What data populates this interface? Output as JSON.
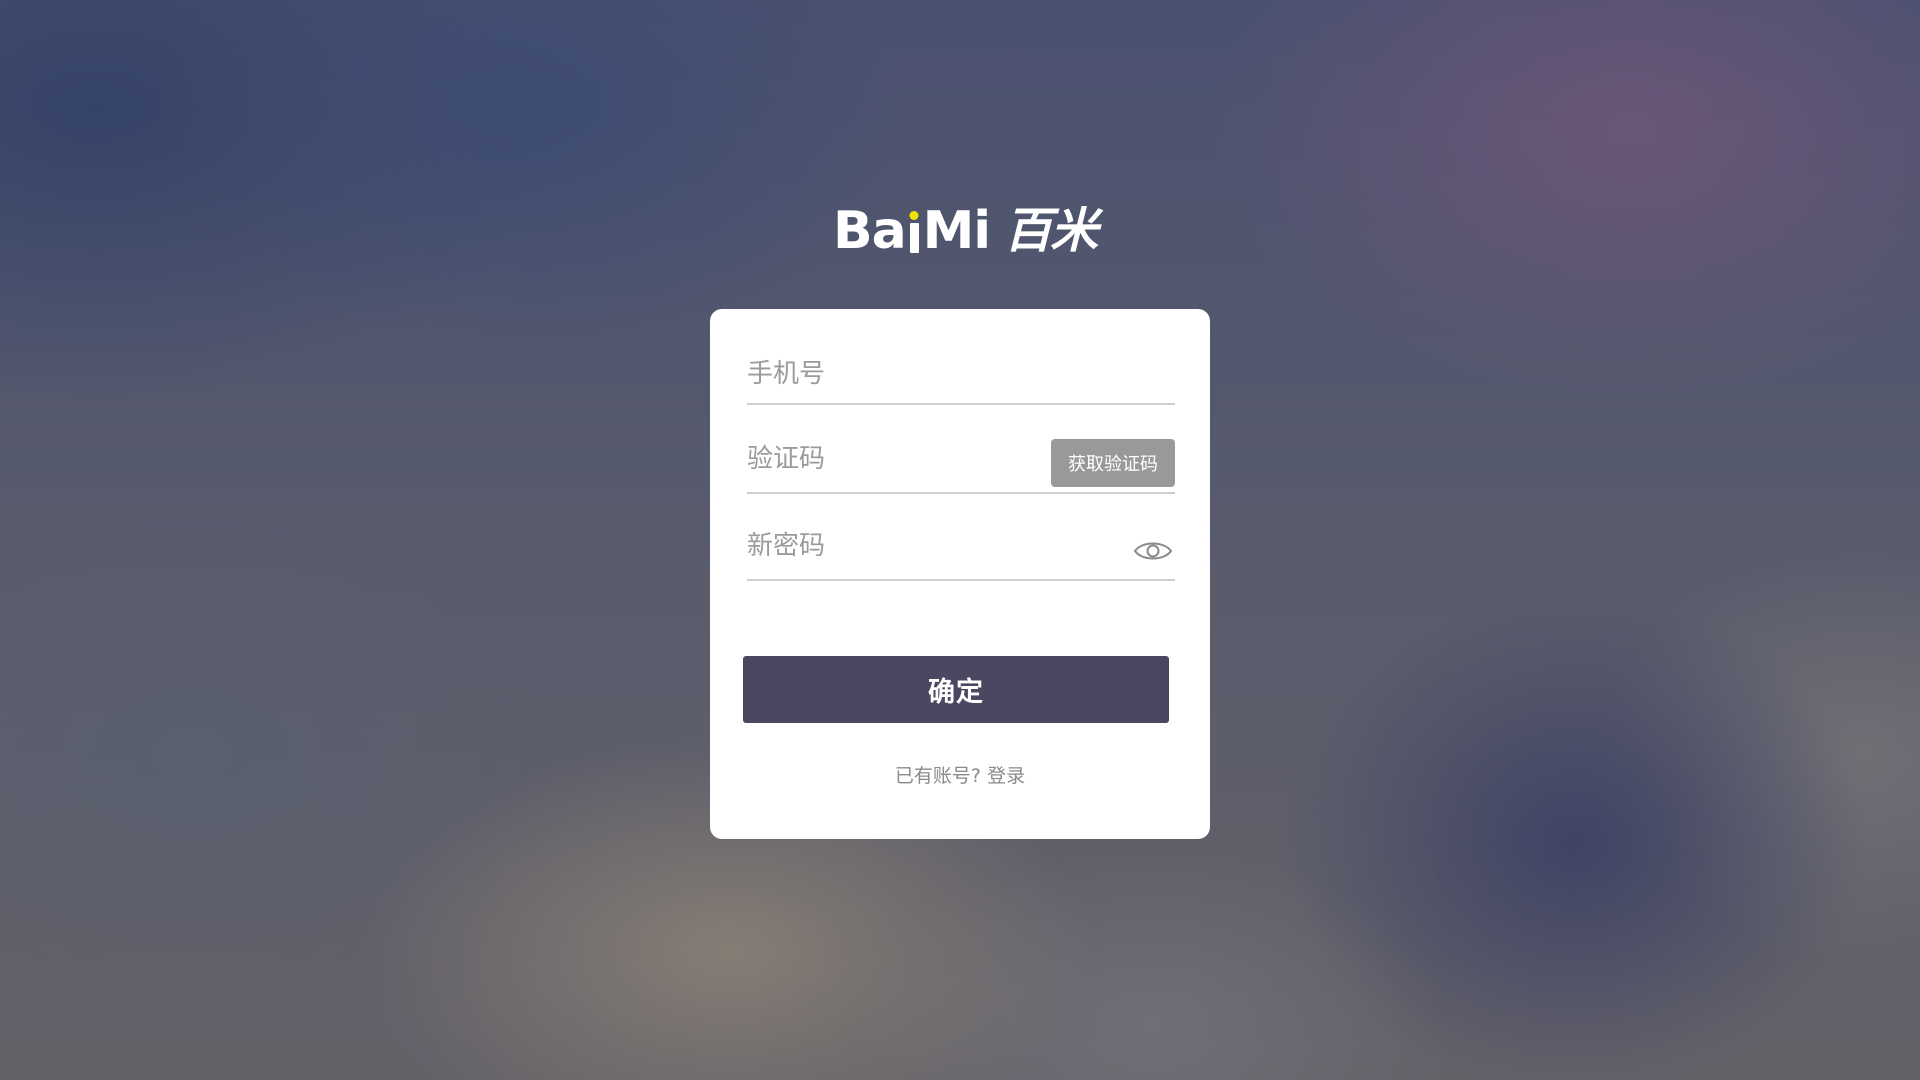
{
  "logo": {
    "latin_b": "B",
    "latin_a": "a",
    "latin_i": "i",
    "latin_mi": "Mi",
    "cjk": "百米",
    "accent_color": "#f2e300"
  },
  "form": {
    "phone_placeholder": "手机号",
    "code_placeholder": "验证码",
    "get_code_label": "获取验证码",
    "password_placeholder": "新密码",
    "eye_icon": "eye-icon",
    "confirm_label": "确定",
    "has_account_text": "已有账号?",
    "login_link": "登录"
  },
  "colors": {
    "button_primary": "#4a4861",
    "button_secondary": "#999999"
  }
}
